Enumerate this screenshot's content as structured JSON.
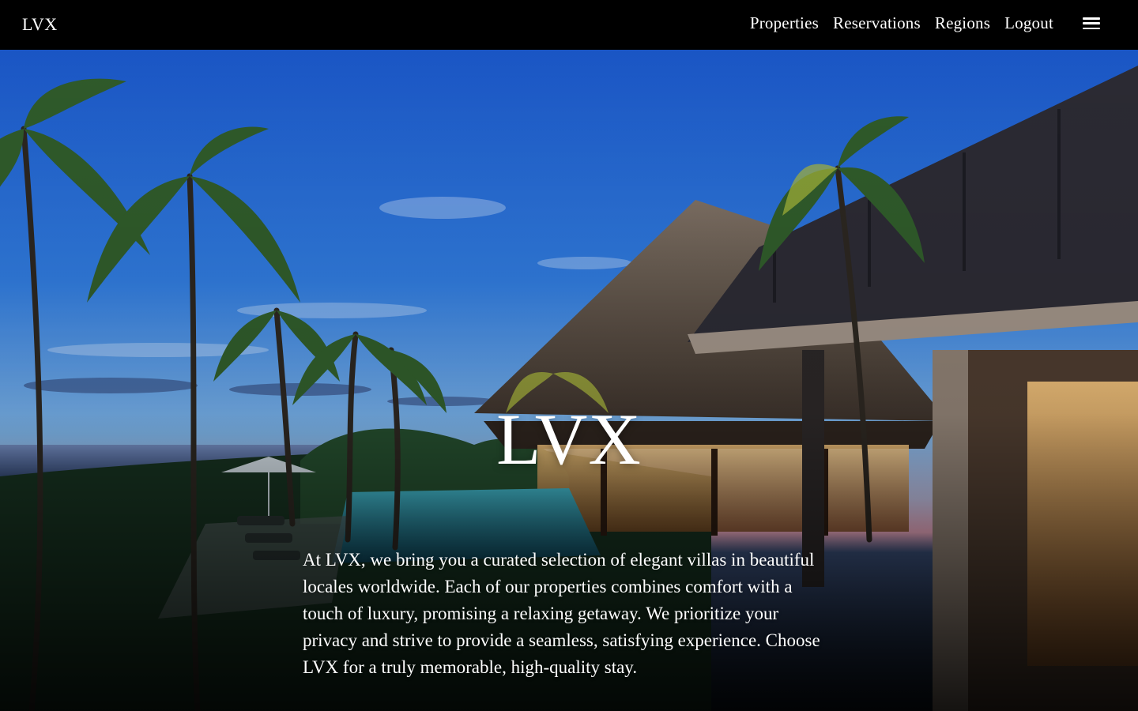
{
  "header": {
    "brand": "LVX",
    "nav": [
      {
        "label": "Properties"
      },
      {
        "label": "Reservations"
      },
      {
        "label": "Regions"
      },
      {
        "label": "Logout"
      }
    ],
    "menu_icon": "hamburger-menu-icon"
  },
  "hero": {
    "title": "LVX",
    "description": "At LVX, we bring you a curated selection of elegant villas in beautiful locales worldwide. Each of our properties combines comfort with a touch of luxury, promising a relaxing getaway. We prioritize your privacy and strive to provide a seamless, satisfying experience. Choose LVX for a truly memorable, high-quality stay.",
    "image_subject": "tropical villa with thatched palapa roof, infinity pool and palm trees at dusk by the ocean"
  },
  "colors": {
    "nav_background": "#000000",
    "text": "#ffffff",
    "sky_top": "#1f5fc8",
    "sky_horizon": "#e9a0b8",
    "interior_glow": "#e0a45a"
  }
}
